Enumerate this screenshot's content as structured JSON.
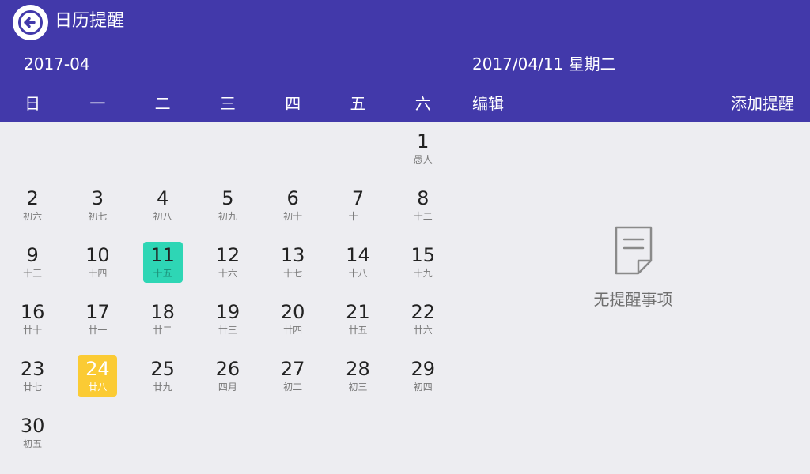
{
  "app": {
    "title": "日历提醒"
  },
  "calendar": {
    "month_label": "2017-04",
    "weekdays": [
      "日",
      "一",
      "二",
      "三",
      "四",
      "五",
      "六"
    ],
    "weeks": [
      [
        null,
        null,
        null,
        null,
        null,
        null,
        {
          "day": "1",
          "lunar": "愚人"
        }
      ],
      [
        {
          "day": "2",
          "lunar": "初六"
        },
        {
          "day": "3",
          "lunar": "初七"
        },
        {
          "day": "4",
          "lunar": "初八"
        },
        {
          "day": "5",
          "lunar": "初九"
        },
        {
          "day": "6",
          "lunar": "初十"
        },
        {
          "day": "7",
          "lunar": "十一"
        },
        {
          "day": "8",
          "lunar": "十二"
        }
      ],
      [
        {
          "day": "9",
          "lunar": "十三"
        },
        {
          "day": "10",
          "lunar": "十四"
        },
        {
          "day": "11",
          "lunar": "十五",
          "state": "selected"
        },
        {
          "day": "12",
          "lunar": "十六"
        },
        {
          "day": "13",
          "lunar": "十七"
        },
        {
          "day": "14",
          "lunar": "十八"
        },
        {
          "day": "15",
          "lunar": "十九"
        }
      ],
      [
        {
          "day": "16",
          "lunar": "廿十"
        },
        {
          "day": "17",
          "lunar": "廿一"
        },
        {
          "day": "18",
          "lunar": "廿二"
        },
        {
          "day": "19",
          "lunar": "廿三"
        },
        {
          "day": "20",
          "lunar": "廿四"
        },
        {
          "day": "21",
          "lunar": "廿五"
        },
        {
          "day": "22",
          "lunar": "廿六"
        }
      ],
      [
        {
          "day": "23",
          "lunar": "廿七"
        },
        {
          "day": "24",
          "lunar": "廿八",
          "state": "highlighted"
        },
        {
          "day": "25",
          "lunar": "廿九"
        },
        {
          "day": "26",
          "lunar": "四月"
        },
        {
          "day": "27",
          "lunar": "初二"
        },
        {
          "day": "28",
          "lunar": "初三"
        },
        {
          "day": "29",
          "lunar": "初四"
        }
      ],
      [
        {
          "day": "30",
          "lunar": "初五"
        },
        null,
        null,
        null,
        null,
        null,
        null
      ]
    ]
  },
  "detail": {
    "date_label": "2017/04/11 星期二",
    "edit_label": "编辑",
    "add_label": "添加提醒",
    "empty_text": "无提醒事项"
  },
  "icons": {
    "back": "back-arrow-icon",
    "empty": "document-icon"
  },
  "colors": {
    "header": "#4239aa",
    "selected": "#2ed6b5",
    "highlighted": "#fbcb34",
    "background": "#ededf1"
  }
}
